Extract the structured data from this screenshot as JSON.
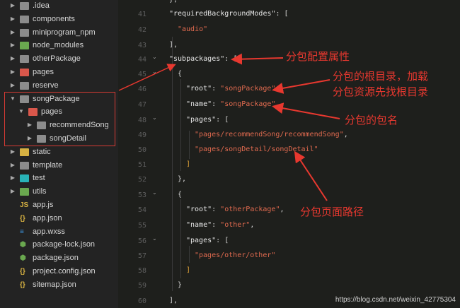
{
  "explorer": {
    "items": [
      {
        "label": ".idea",
        "chevron": "▶",
        "icon": "grey",
        "depth": 0
      },
      {
        "label": "components",
        "chevron": "▶",
        "icon": "grey",
        "depth": 0
      },
      {
        "label": "miniprogram_npm",
        "chevron": "▶",
        "icon": "grey",
        "depth": 0
      },
      {
        "label": "node_modules",
        "chevron": "▶",
        "icon": "green",
        "depth": 0
      },
      {
        "label": "otherPackage",
        "chevron": "▶",
        "icon": "grey",
        "depth": 0
      },
      {
        "label": "pages",
        "chevron": "▶",
        "icon": "red",
        "depth": 0
      },
      {
        "label": "reserve",
        "chevron": "▶",
        "icon": "grey",
        "depth": 0
      },
      {
        "label": "songPackage",
        "chevron": "▼",
        "icon": "grey",
        "depth": 0
      },
      {
        "label": "pages",
        "chevron": "▼",
        "icon": "red",
        "depth": 1
      },
      {
        "label": "recommendSong",
        "chevron": "▶",
        "icon": "grey",
        "depth": 2
      },
      {
        "label": "songDetail",
        "chevron": "▶",
        "icon": "grey",
        "depth": 2
      },
      {
        "label": "static",
        "chevron": "▶",
        "icon": "yellow",
        "depth": 0
      },
      {
        "label": "template",
        "chevron": "▶",
        "icon": "grey",
        "depth": 0
      },
      {
        "label": "test",
        "chevron": "▶",
        "icon": "teal",
        "depth": 0
      },
      {
        "label": "utils",
        "chevron": "▶",
        "icon": "green",
        "depth": 0
      },
      {
        "label": "app.js",
        "chevron": "",
        "icon": "js",
        "depth": 0
      },
      {
        "label": "app.json",
        "chevron": "",
        "icon": "json",
        "depth": 0
      },
      {
        "label": "app.wxss",
        "chevron": "",
        "icon": "css",
        "depth": 0
      },
      {
        "label": "package-lock.json",
        "chevron": "",
        "icon": "node",
        "depth": 0
      },
      {
        "label": "package.json",
        "chevron": "",
        "icon": "node",
        "depth": 0
      },
      {
        "label": "project.config.json",
        "chevron": "",
        "icon": "json",
        "depth": 0
      },
      {
        "label": "sitemap.json",
        "chevron": "",
        "icon": "json",
        "depth": 0
      }
    ]
  },
  "editor": {
    "line_numbers": [
      "41",
      "42",
      "43",
      "44",
      "45",
      "46",
      "47",
      "48",
      "49",
      "50",
      "51",
      "52",
      "53",
      "54",
      "55",
      "56",
      "57",
      "58",
      "59",
      "60"
    ],
    "lines": {
      "l41": {
        "key": "\"requiredBackgroundModes\"",
        "punct": ": ["
      },
      "l42": {
        "str": "\"audio\""
      },
      "l43": {
        "punct": "],"
      },
      "l44": {
        "key": "\"subpackages\"",
        "punct": ": ["
      },
      "l45": {
        "punct": "{"
      },
      "l46": {
        "key": "\"root\"",
        "punct": ": ",
        "str": "\"songPackage\"",
        "tail": ","
      },
      "l47": {
        "key": "\"name\"",
        "punct": ": ",
        "str": "\"songPackage\"",
        "tail": ","
      },
      "l48": {
        "key": "\"pages\"",
        "punct": ": ["
      },
      "l49": {
        "str": "\"pages/recommendSong/recommendSong\"",
        "tail": ","
      },
      "l50": {
        "str": "\"pages/songDetail/songDetail\""
      },
      "l51": {
        "punct": "]"
      },
      "l52": {
        "punct": "},"
      },
      "l53": {
        "punct": "{"
      },
      "l54": {
        "key": "\"root\"",
        "punct": ": ",
        "str": "\"otherPackage\"",
        "tail": ","
      },
      "l55": {
        "key": "\"name\"",
        "punct": ": ",
        "str": "\"other\"",
        "tail": ","
      },
      "l56": {
        "key": "\"pages\"",
        "punct": ": ["
      },
      "l57": {
        "str": "\"pages/other/other\""
      },
      "l58": {
        "punct": "]"
      },
      "l59": {
        "punct": "}"
      },
      "l60": {
        "punct": "],"
      }
    }
  },
  "annotations": {
    "subpackage_config": "分包配置属性",
    "root_line1": "分包的根目录，加载",
    "root_line2": "分包资源先找根目录",
    "package_name": "分包的包名",
    "page_path": "分包页面路径",
    "arrow_color": "#e8382f"
  },
  "watermark": "https://blog.csdn.net/weixin_42775304"
}
